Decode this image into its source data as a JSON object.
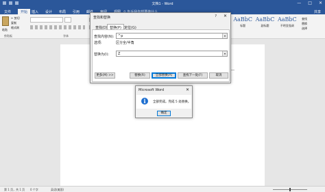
{
  "window": {
    "title": "文档1 - Word",
    "controls": [
      "—",
      "□",
      "✕"
    ]
  },
  "ribbon_tabs": [
    "文件",
    "开始",
    "插入",
    "设计",
    "布局",
    "引用",
    "邮件",
    "审阅",
    "视图"
  ],
  "active_tab": "开始",
  "tell_me": "♀ 告诉我你想要做什么",
  "share": "共享",
  "clipboard": {
    "paste": "粘贴",
    "cut": "✂ 剪切",
    "copy": "复制",
    "format_painter": "格式刷",
    "group_label": "剪贴板"
  },
  "font_group_label": "字体",
  "styles": [
    {
      "preview": "AaBbC",
      "name": "标题"
    },
    {
      "preview": "AaBbC",
      "name": "副标题"
    },
    {
      "preview": "AaBbC",
      "name": "不明显强调"
    }
  ],
  "editing": {
    "find": "查找",
    "replace": "替换",
    "select": "选择"
  },
  "find_replace": {
    "title": "查找和替换",
    "help": "?",
    "close": "✕",
    "tabs": [
      "查找(D)",
      "替换(P)",
      "定位(G)"
    ],
    "active_tab": "替换(P)",
    "find_label": "查找内容(N):",
    "find_value": "^p",
    "options_label": "选项:",
    "options_value": "区分全/半角",
    "replace_label": "替换为(I):",
    "replace_value": "Z",
    "buttons": {
      "more": "更多(M) >>",
      "replace": "替换(R)",
      "replace_all": "全部替换(A)",
      "find_next": "查找下一处(F)",
      "cancel": "取消"
    }
  },
  "message_box": {
    "title": "Microsoft Word",
    "close": "✕",
    "text": "全部完成。完成 5 处替换。",
    "ok": "确定"
  },
  "status_bar": {
    "page": "第 1 页，共 1 页",
    "words": "0 个字",
    "language": "英语(美国)"
  },
  "colors": {
    "title_bar": "#2b579a",
    "info_icon": "#1e6fd0",
    "focus": "#0078d7"
  }
}
